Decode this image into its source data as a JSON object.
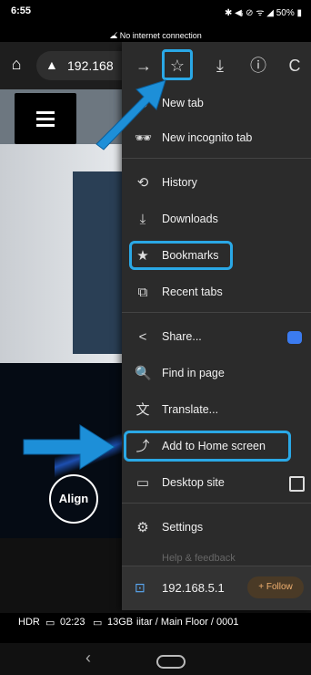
{
  "status_bar": {
    "time": "6:55",
    "right": "✱ ◀ᵢ ⊘ ᯤ ◢ 50% ▮"
  },
  "notice": {
    "text": "No internet connection",
    "icon": "cloud-off-icon"
  },
  "url_bar": {
    "home_icon": "⌂",
    "url": "192.168",
    "warning_icon": "▲"
  },
  "toolbar": {
    "forward": "→",
    "bookmark": "☆",
    "download": "⤓",
    "info": "ⓘ",
    "reload": "C"
  },
  "menu": {
    "items": [
      {
        "label": "New tab",
        "icon": "⊕"
      },
      {
        "label": "New incognito tab",
        "icon": "🕶"
      },
      {
        "label": "History",
        "icon": "⟲"
      },
      {
        "label": "Downloads",
        "icon": "⤓"
      },
      {
        "label": "Bookmarks",
        "icon": "★"
      },
      {
        "label": "Recent tabs",
        "icon": "⧉"
      },
      {
        "label": "Share...",
        "icon": "<"
      },
      {
        "label": "Find in page",
        "icon": "🔍"
      },
      {
        "label": "Translate...",
        "icon": "文"
      },
      {
        "label": "Add to Home screen",
        "icon": "⤴"
      },
      {
        "label": "Desktop site",
        "icon": "▭"
      },
      {
        "label": "Settings",
        "icon": "⚙"
      }
    ],
    "faded_item": "Help & feedback",
    "footer": {
      "url": "192.168.5.1",
      "follow": "+ Follow"
    }
  },
  "app": {
    "align_label": "Align",
    "hdr": "HDR",
    "battery_time": "02:23",
    "storage": "13GB",
    "path": "iitar / Main Floor / 0001"
  },
  "colors": {
    "highlight": "#2aa8e6",
    "menu_bg": "#2b2b2b"
  }
}
